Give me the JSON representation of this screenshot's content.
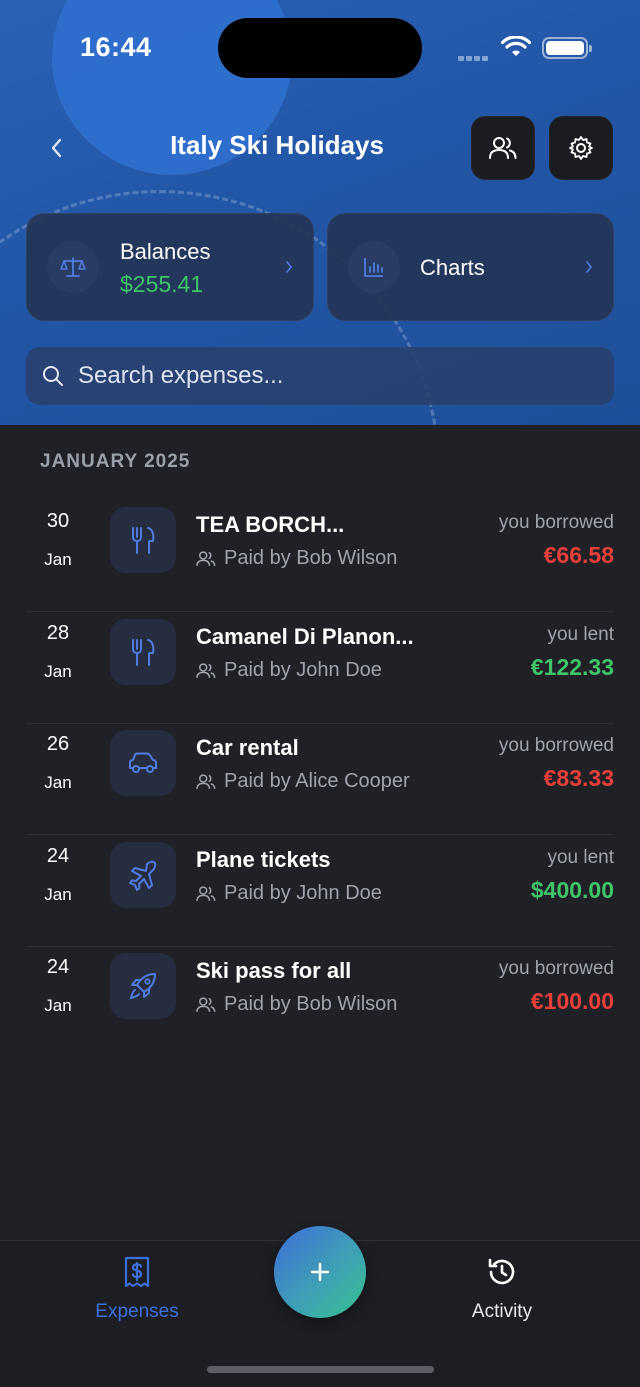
{
  "status_bar": {
    "time": "16:44"
  },
  "header": {
    "title": "Italy Ski Holidays",
    "back_icon": "chevron-left-icon",
    "members_icon": "users-icon",
    "settings_icon": "gear-icon"
  },
  "cards": {
    "balances": {
      "label": "Balances",
      "value": "$255.41",
      "icon": "scale-icon"
    },
    "charts": {
      "label": "Charts",
      "icon": "bar-chart-icon"
    }
  },
  "search": {
    "placeholder": "Search expenses..."
  },
  "month_header": "JANUARY 2025",
  "expenses": [
    {
      "day": "30",
      "month": "Jan",
      "icon": "utensils-icon",
      "title": "TEA BORCH...",
      "paid_by": "Paid by Bob Wilson",
      "relation": "you borrowed",
      "amount": "€66.58",
      "type": "borrowed"
    },
    {
      "day": "28",
      "month": "Jan",
      "icon": "utensils-icon",
      "title": "Camanel Di Planon...",
      "paid_by": "Paid by John Doe",
      "relation": "you lent",
      "amount": "€122.33",
      "type": "lent"
    },
    {
      "day": "26",
      "month": "Jan",
      "icon": "car-icon",
      "title": "Car rental",
      "paid_by": "Paid by Alice Cooper",
      "relation": "you borrowed",
      "amount": "€83.33",
      "type": "borrowed"
    },
    {
      "day": "24",
      "month": "Jan",
      "icon": "plane-icon",
      "title": "Plane tickets",
      "paid_by": "Paid by John Doe",
      "relation": "you lent",
      "amount": "$400.00",
      "type": "lent"
    },
    {
      "day": "24",
      "month": "Jan",
      "icon": "rocket-icon",
      "title": "Ski pass for all",
      "paid_by": "Paid by Bob Wilson",
      "relation": "you borrowed",
      "amount": "€100.00",
      "type": "borrowed"
    }
  ],
  "tabbar": {
    "expenses_label": "Expenses",
    "activity_label": "Activity",
    "add_icon": "plus-icon",
    "active_color": "#3d6fd9"
  },
  "colors": {
    "negative": "#e83f3a",
    "positive": "#3fc46a",
    "accent": "#3d6fd9"
  }
}
